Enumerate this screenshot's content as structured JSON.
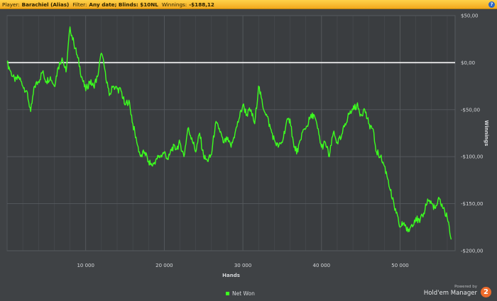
{
  "header": {
    "player_label": "Player:",
    "player_value": "Barachiel (Alias)",
    "filter_label": "Filter:",
    "filter_value": "Any date; Blinds: $10NL",
    "winnings_label": "Winnings:",
    "winnings_value": "-$188,12",
    "help_label": "?"
  },
  "branding": {
    "powered_by": "Powered by",
    "name": "Hold'em Manager",
    "logo_text": "2"
  },
  "colors": {
    "background": "#3f4245",
    "grid": "#565a5e",
    "series": "#3cff1f",
    "zero_line": "#ffffff",
    "header": "#f5b52a"
  },
  "chart_data": {
    "type": "line",
    "xlabel": "Hands",
    "ylabel": "Winnings",
    "xlim": [
      0,
      57000
    ],
    "ylim": [
      -200,
      50
    ],
    "x_ticks": [
      10000,
      20000,
      30000,
      40000,
      50000
    ],
    "x_tick_labels": [
      "10 000",
      "20 000",
      "30 000",
      "40 000",
      "50 000"
    ],
    "y_ticks": [
      50,
      0,
      -50,
      -100,
      -150,
      -200
    ],
    "y_tick_labels": [
      "$50,00",
      "$0,00",
      "-$50,00",
      "-$100,00",
      "-$150,00",
      "-$200,00"
    ],
    "grid": true,
    "legend_position": "bottom-center",
    "zero_line": 0,
    "series": [
      {
        "name": "Net Won",
        "x": [
          0,
          500,
          1000,
          1500,
          2000,
          2500,
          3000,
          3500,
          4000,
          4500,
          5000,
          5500,
          6000,
          6500,
          7000,
          7500,
          8000,
          8500,
          9000,
          9500,
          10000,
          10500,
          11000,
          11500,
          12000,
          12500,
          13000,
          13500,
          14000,
          14500,
          15000,
          15500,
          16000,
          16500,
          17000,
          17500,
          18000,
          18500,
          19000,
          19500,
          20000,
          20500,
          21000,
          21500,
          22000,
          22500,
          23000,
          23500,
          24000,
          24500,
          25000,
          25500,
          26000,
          26500,
          27000,
          27500,
          28000,
          28500,
          29000,
          29500,
          30000,
          30500,
          31000,
          31500,
          32000,
          32500,
          33000,
          33500,
          34000,
          34500,
          35000,
          35500,
          36000,
          36500,
          37000,
          37500,
          38000,
          38500,
          39000,
          39500,
          40000,
          40500,
          41000,
          41500,
          42000,
          42500,
          43000,
          43500,
          44000,
          44500,
          45000,
          45500,
          46000,
          46500,
          47000,
          47500,
          48000,
          48500,
          49000,
          49500,
          50000,
          50500,
          51000,
          51500,
          52000,
          52500,
          53000,
          53500,
          54000,
          54500,
          55000,
          55500,
          56000,
          56500
        ],
        "y": [
          0,
          -10,
          -20,
          -15,
          -25,
          -30,
          -52,
          -25,
          -20,
          -10,
          -20,
          -15,
          -25,
          -5,
          5,
          -10,
          38,
          20,
          5,
          -15,
          -30,
          -20,
          -25,
          -15,
          10,
          -10,
          -35,
          -25,
          -28,
          -30,
          -45,
          -40,
          -65,
          -85,
          -100,
          -95,
          -105,
          -110,
          -102,
          -100,
          -95,
          -103,
          -90,
          -92,
          -85,
          -100,
          -70,
          -80,
          -95,
          -75,
          -100,
          -105,
          -98,
          -65,
          -70,
          -85,
          -82,
          -90,
          -75,
          -60,
          -45,
          -55,
          -50,
          -65,
          -25,
          -45,
          -55,
          -70,
          -82,
          -90,
          -85,
          -65,
          -60,
          -90,
          -95,
          -75,
          -70,
          -60,
          -55,
          -70,
          -90,
          -85,
          -100,
          -75,
          -85,
          -80,
          -65,
          -55,
          -50,
          -45,
          -55,
          -50,
          -65,
          -70,
          -95,
          -100,
          -110,
          -125,
          -145,
          -160,
          -175,
          -170,
          -180,
          -172,
          -165,
          -170,
          -160,
          -145,
          -150,
          -155,
          -145,
          -155,
          -165,
          -188
        ]
      }
    ]
  }
}
